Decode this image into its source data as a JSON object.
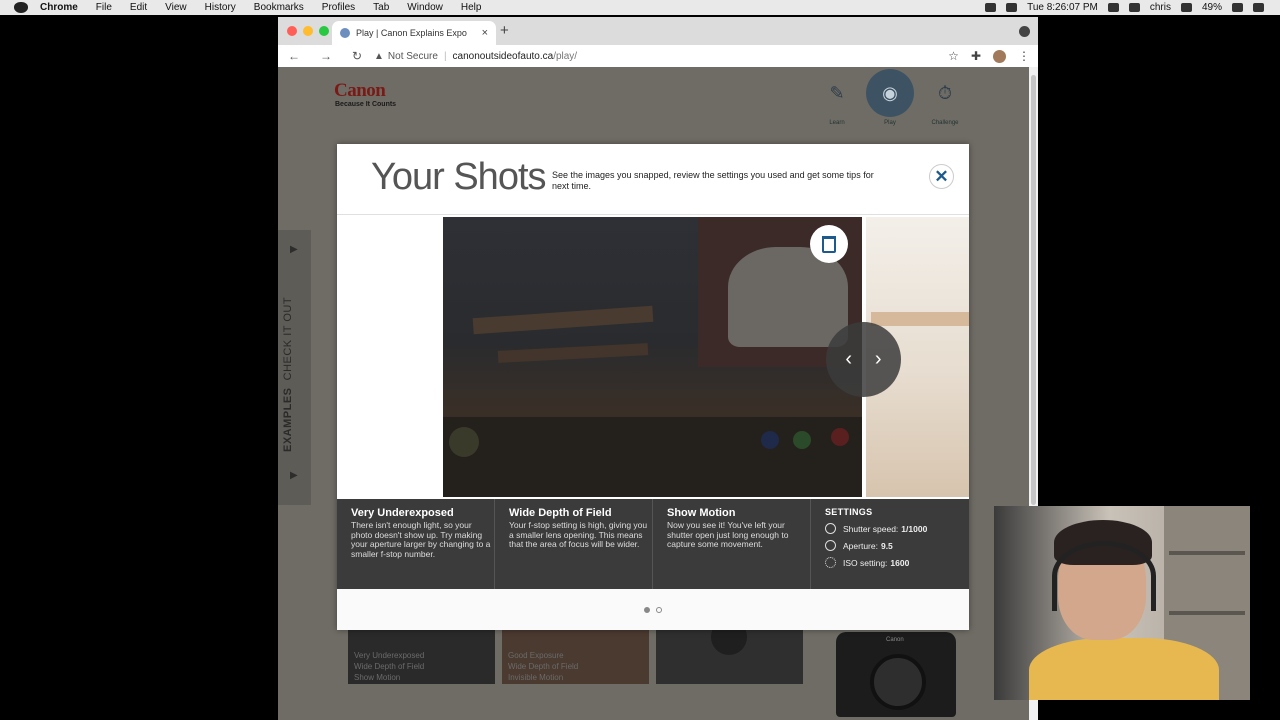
{
  "menubar": {
    "app": "Chrome",
    "items": [
      "File",
      "Edit",
      "View",
      "History",
      "Bookmarks",
      "Profiles",
      "Tab",
      "Window",
      "Help"
    ],
    "time": "Tue 8:26:07 PM",
    "user": "chris",
    "battery": "49%"
  },
  "browser": {
    "tab_title": "Play | Canon Explains Expo",
    "security": "Not Secure",
    "url_host": "canonoutsideofauto.ca",
    "url_path": "/play/",
    "light_colors": [
      "#ff5f57",
      "#febc2e",
      "#28c840"
    ]
  },
  "site": {
    "logo": "Canon",
    "tagline": "Because It Counts",
    "nav": [
      {
        "label": "Learn",
        "icon": "book-pencil-icon"
      },
      {
        "label": "Play",
        "icon": "camera-icon"
      },
      {
        "label": "Challenge",
        "icon": "stopwatch-icon"
      }
    ],
    "side_panel": {
      "bold": "EXAMPLES",
      "rest": "CHECK IT OUT"
    },
    "thumbnails": [
      {
        "lines": [
          "Very Underexposed",
          "Wide Depth of Field",
          "Show Motion"
        ]
      },
      {
        "lines": [
          "Good Exposure",
          "Wide Depth of Field",
          "Invisible Motion"
        ]
      }
    ],
    "camera_brand": "Canon"
  },
  "modal": {
    "title": "Your Shots",
    "subtitle": "See the images you snapped, review the settings you used and get some tips for next time.",
    "close": "✕",
    "prev": "‹",
    "next": "›",
    "cards": [
      {
        "title": "Very Underexposed",
        "text": "There isn't enough light, so your photo doesn't show up. Try making your aperture larger by changing to a smaller f-stop number."
      },
      {
        "title": "Wide Depth of Field",
        "text": "Your f-stop setting is high, giving you a smaller lens opening. This means that the area of focus will be wider."
      },
      {
        "title": "Show Motion",
        "text": "Now you see it! You've left your shutter open just long enough to capture some movement."
      }
    ],
    "settings": {
      "heading": "SETTINGS",
      "rows": [
        {
          "label": "Shutter speed:",
          "value": "1/1000",
          "icon": "shutter-icon"
        },
        {
          "label": "Aperture:",
          "value": "9.5",
          "icon": "aperture-icon"
        },
        {
          "label": "ISO setting:",
          "value": "1600",
          "icon": "sun-icon"
        }
      ]
    },
    "pages_total": 2,
    "page_current": 1
  }
}
